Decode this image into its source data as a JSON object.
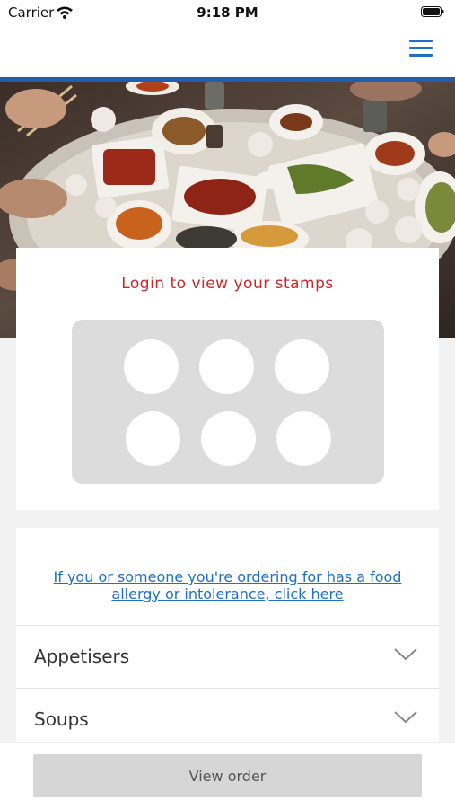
{
  "status_bar": {
    "carrier": "Carrier",
    "time": "9:18 PM"
  },
  "icons": {
    "wifi": "wifi-icon",
    "battery": "battery-icon",
    "menu": "hamburger-menu-icon",
    "chevron": "chevron-down-icon"
  },
  "colors": {
    "accent": "#1f6fc4",
    "nav_rule": "#1f5fb0",
    "login_title": "#c62828",
    "stamp_panel": "#dcdcdc"
  },
  "stamp_card": {
    "title": "Login to view your stamps",
    "stamp_count": 6
  },
  "allergy": {
    "link_text": "If you or someone you're ordering for has a food allergy or intolerance, click here"
  },
  "categories": [
    {
      "label": "Appetisers"
    },
    {
      "label": "Soups"
    }
  ],
  "footer": {
    "view_order_label": "View order"
  }
}
